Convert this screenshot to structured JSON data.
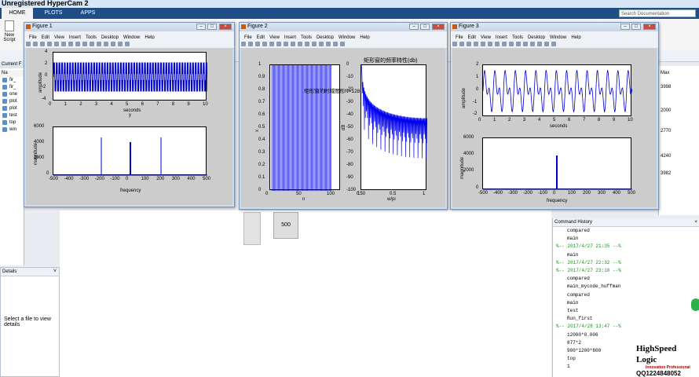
{
  "window": {
    "title": "Unregistered HyperCam 2"
  },
  "ribbon": {
    "tabs": [
      "HOME",
      "PLOTS",
      "APPS"
    ],
    "search_placeholder": "Search Documentation",
    "new_script": "New Script"
  },
  "current_folder": {
    "title": "Current F",
    "column": "Na",
    "files": [
      "fir_",
      "fir_",
      "one",
      "plot",
      "plot",
      "test",
      "top",
      "win"
    ]
  },
  "details": {
    "title": "Details",
    "message": "Select a file to view details"
  },
  "workspace": {
    "header": "Max",
    "values": [
      "3998",
      "2000",
      "2770",
      "4240",
      "3982"
    ]
  },
  "misc": {
    "value_500": "500"
  },
  "history": {
    "title": "Command History",
    "entries": [
      {
        "type": "cmd",
        "text": "compared"
      },
      {
        "type": "cmd",
        "text": "main"
      },
      {
        "type": "sec",
        "text": "%-- 2017/4/27 21:35 --%"
      },
      {
        "type": "cmd",
        "text": "main"
      },
      {
        "type": "sec",
        "text": "%-- 2017/4/27 22:32 --%"
      },
      {
        "type": "sec",
        "text": "%-- 2017/4/27 23:10 --%"
      },
      {
        "type": "cmd",
        "text": "compared"
      },
      {
        "type": "cmd",
        "text": "main_mycode_huffman"
      },
      {
        "type": "cmd",
        "text": "compared"
      },
      {
        "type": "cmd",
        "text": "main"
      },
      {
        "type": "cmd",
        "text": "test"
      },
      {
        "type": "cmd",
        "text": "Run_first"
      },
      {
        "type": "sec",
        "text": "%-- 2017/4/28 13:47 --%"
      },
      {
        "type": "cmd",
        "text": "12000*0.006"
      },
      {
        "type": "cmd",
        "text": "877*2"
      },
      {
        "type": "cmd",
        "text": "900*1200*800"
      },
      {
        "type": "cmd",
        "text": "top"
      },
      {
        "type": "cmd",
        "text": "1"
      }
    ]
  },
  "figure_menu": [
    "File",
    "Edit",
    "View",
    "Insert",
    "Tools",
    "Desktop",
    "Window",
    "Help"
  ],
  "figures": [
    {
      "title": "Figure 1",
      "top_plot": {
        "ylabel": "amplitude",
        "xlabel": "seconds",
        "yticks": [
          "4",
          "2",
          "0",
          "-2",
          "-4"
        ],
        "xticks": [
          "0",
          "1",
          "2",
          "3",
          "4",
          "5",
          "6",
          "7",
          "8",
          "9",
          "10"
        ],
        "note": "y"
      },
      "bottom_plot": {
        "ylabel": "magnitude",
        "xlabel": "frequency",
        "yticks": [
          "6000",
          "4000",
          "2000",
          "0"
        ],
        "xticks": [
          "-500",
          "-400",
          "-300",
          "-200",
          "-100",
          "0",
          "100",
          "200",
          "300",
          "400",
          "500"
        ]
      }
    },
    {
      "title": "Figure 2",
      "left_plot": {
        "xlabel": "n",
        "ylabel": "x",
        "yticks": [
          "1",
          "0.9",
          "0.8",
          "0.7",
          "0.6",
          "0.5",
          "0.4",
          "0.3",
          "0.2",
          "0.1",
          "0"
        ],
        "xticks": [
          "0",
          "50",
          "100",
          "150"
        ]
      },
      "right_plot": {
        "title": "矩形窗的频率特性(db)",
        "xlabel": "w/pi",
        "ylabel": "dB",
        "yticks": [
          "0",
          "-10",
          "-20",
          "-30",
          "-40",
          "-50",
          "-60",
          "-70",
          "-80",
          "-90",
          "-100"
        ],
        "xticks": [
          "0",
          "0.5",
          "1"
        ]
      },
      "overlay": "矩形窗的时域图形N=128"
    },
    {
      "title": "Figure 3",
      "top_plot": {
        "ylabel": "amplitude",
        "xlabel": "seconds",
        "yticks": [
          "2",
          "1",
          "0",
          "-1",
          "-2"
        ],
        "xticks": [
          "0",
          "1",
          "2",
          "3",
          "4",
          "5",
          "6",
          "7",
          "8",
          "9",
          "10"
        ]
      },
      "bottom_plot": {
        "ylabel": "magnitude",
        "xlabel": "frequency",
        "yticks": [
          "6000",
          "4000",
          "2000",
          "0"
        ],
        "xticks": [
          "-500",
          "-400",
          "-300",
          "-200",
          "-100",
          "0",
          "100",
          "200",
          "300",
          "400",
          "500"
        ]
      }
    }
  ],
  "logo": {
    "line1": "HighSpeed",
    "line2": "Logic",
    "tagline": "Innovation Professional",
    "qq": "QQ1224848052"
  }
}
